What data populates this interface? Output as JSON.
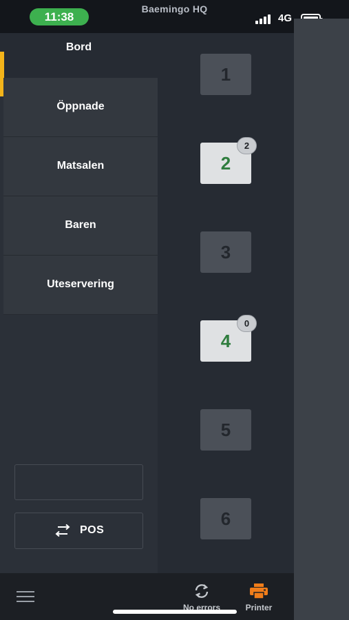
{
  "status_bar": {
    "time": "11:38",
    "carrier_title": "Baemingo HQ",
    "network": "4G",
    "time_pill_color": "#3db04f"
  },
  "sidebar": {
    "header": "Bord",
    "accent_color": "#f3b41a",
    "items": [
      {
        "label": "Öppnade"
      },
      {
        "label": "Matsalen"
      },
      {
        "label": "Baren"
      },
      {
        "label": "Uteservering"
      }
    ],
    "bottom_field_value": "",
    "pos_button": {
      "label": "POS",
      "icon": "swap-arrows-icon"
    }
  },
  "tables": [
    {
      "number": "1",
      "active": false,
      "badge": null
    },
    {
      "number": "2",
      "active": true,
      "badge": "2"
    },
    {
      "number": "3",
      "active": false,
      "badge": null
    },
    {
      "number": "4",
      "active": true,
      "badge": "0"
    },
    {
      "number": "5",
      "active": false,
      "badge": null
    },
    {
      "number": "6",
      "active": false,
      "badge": null
    }
  ],
  "toolbar": {
    "menu_icon": "hamburger-menu-icon",
    "sync": {
      "label": "No errors",
      "icon": "sync-icon"
    },
    "printer": {
      "label": "Printer",
      "icon": "printer-icon",
      "color": "#f07d1a"
    }
  }
}
